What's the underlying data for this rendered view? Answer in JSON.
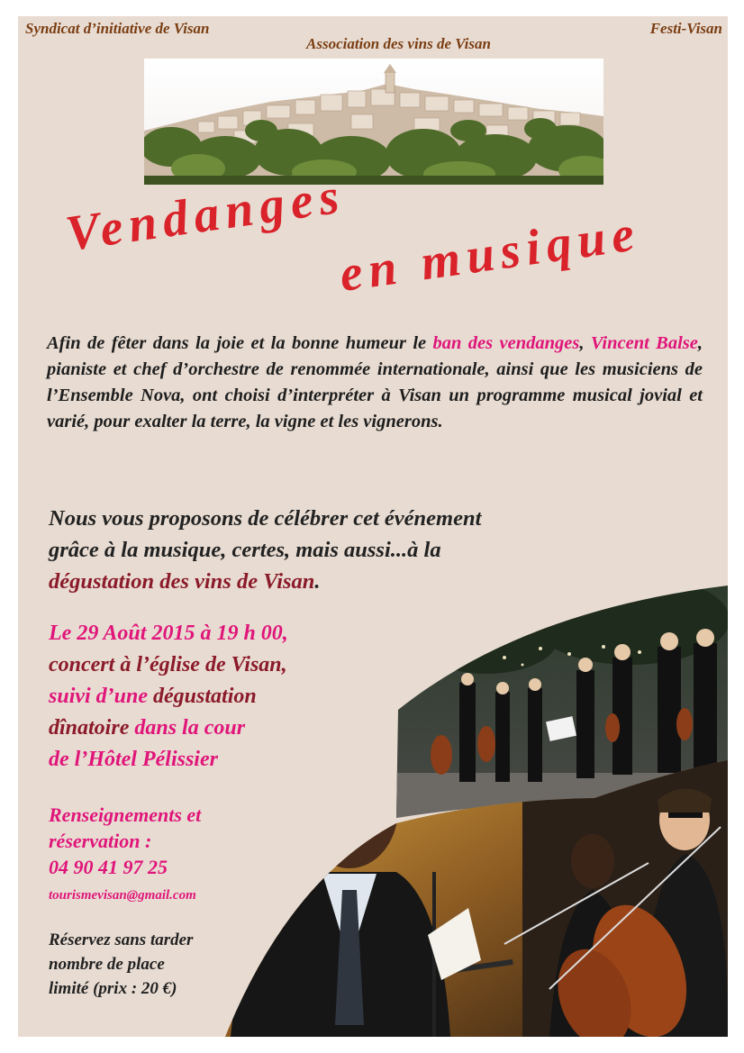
{
  "header": {
    "left": "Syndicat d’initiative de Visan",
    "center": "Association des vins de Visan",
    "right": "Festi-Visan"
  },
  "title": {
    "line1": "Vendanges",
    "line2": "en musique"
  },
  "intro": {
    "p1": "Afin de fêter dans la joie et la bonne humeur le ",
    "highlight1": "ban des vendanges",
    "p2": ",",
    "highlight2": "Vincent Balse",
    "p3": ", pianiste et chef d’orchestre de renommée internationale, ainsi que les musiciens de l’Ensemble Nova, ont choisi d’interpréter à Visan un programme musical jovial et varié, pour exalter la terre, la vigne et les vignerons."
  },
  "propose": {
    "line1": "Nous vous proposons de célébrer cet événement",
    "line2": "grâce à la musique, certes, mais aussi...à la",
    "line3": "dégustation des vins de Visan",
    "line3_end": "."
  },
  "event": {
    "line1": "Le 29 Août 2015 à 19 h 00,",
    "line2": "concert à l’église de Visan,",
    "line3a": "suivi d’une ",
    "line3b": "dégustation",
    "line4a": "dînatoire",
    "line4b": " dans la cour",
    "line5": "de l’Hôtel Pélissier"
  },
  "contact": {
    "line1": "Renseignements et",
    "line2": "réservation :",
    "phone": "04 90 41 97 25",
    "email": "tourismevisan@gmail.com"
  },
  "reserve": {
    "line1": "Réservez sans tarder",
    "line2": "nombre de place",
    "line3": "limité (prix : 20 €)"
  },
  "colors": {
    "background": "#e8dcd2",
    "title_red": "#d9222a",
    "pink": "#e0157a",
    "maroon": "#8b1a2a",
    "header_brown": "#7a3d12"
  }
}
